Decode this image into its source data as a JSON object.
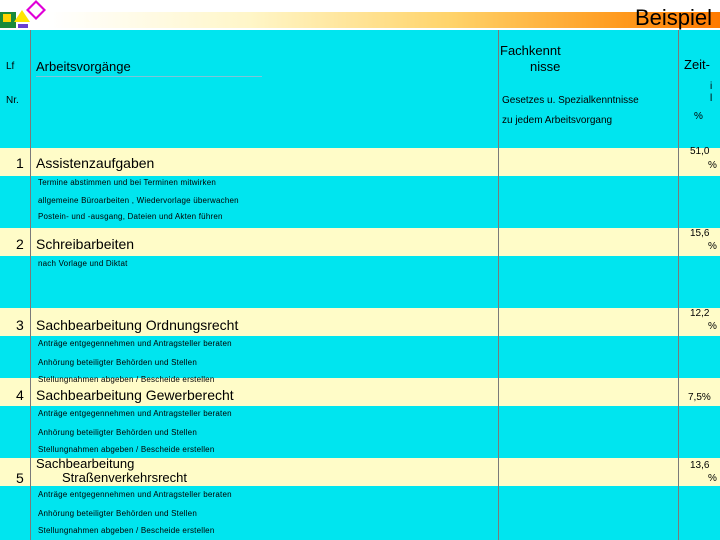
{
  "title": "Beispiel",
  "header": {
    "lf": "Lf",
    "nr": "Nr.",
    "arbeitsvorgaenge": "Arbeitsvorgänge",
    "fachkenntnisse_line1": "Fachkennt",
    "fachkenntnisse_line2": "nisse",
    "gesetzes": "Gesetzes u. Spezialkenntnisse",
    "zu_jedem": "zu jedem Arbeitsvorgang",
    "zeit_line1": "Zeit-",
    "zeit_line2": "i",
    "zeit_line3": "l",
    "zeit_pct": "%"
  },
  "rows": [
    {
      "nr": "1",
      "title": "Assistenzaufgaben",
      "value": "51,0",
      "unit": "%",
      "items": [
        "Termine abstimmen und bei Terminen mitwirken",
        "allgemeine Büroarbeiten , Wiedervorlage überwachen",
        "Postein- und -ausgang, Dateien und Akten führen"
      ]
    },
    {
      "nr": "2",
      "title": "Schreibarbeiten",
      "value": "15,6",
      "unit": "%",
      "items": [
        "nach Vorlage und Diktat"
      ]
    },
    {
      "nr": "3",
      "title": "Sachbearbeitung Ordnungsrecht",
      "value": "12,2",
      "unit": "%",
      "items": [
        "Anträge entgegennehmen und Antragsteller beraten",
        "Anhörung beteiligter Behörden und Stellen",
        "Stellungnahmen abgeben / Bescheide erstellen"
      ]
    },
    {
      "nr": "4",
      "title": "Sachbearbeitung Gewerberecht",
      "value": "7,5%",
      "unit": "",
      "items": [
        "Anträge entgegennehmen und Antragsteller beraten",
        "Anhörung beteiligter Behörden und Stellen",
        "Stellungnahmen abgeben / Bescheide erstellen"
      ]
    },
    {
      "nr": "5",
      "title_line1": "Sachbearbeitung",
      "title_line2": "Straßenverkehrsrecht",
      "value": "13,6",
      "unit": "%",
      "items": [
        "Anträge entgegennehmen und Antragsteller beraten",
        "Anhörung beteiligter Behörden und Stellen",
        "Stellungnahmen abgeben / Bescheide erstellen"
      ]
    }
  ],
  "colors": {
    "table_bg": "#00e5ef",
    "row_band": "#fffcc8",
    "banner_end": "#ff7a00"
  }
}
